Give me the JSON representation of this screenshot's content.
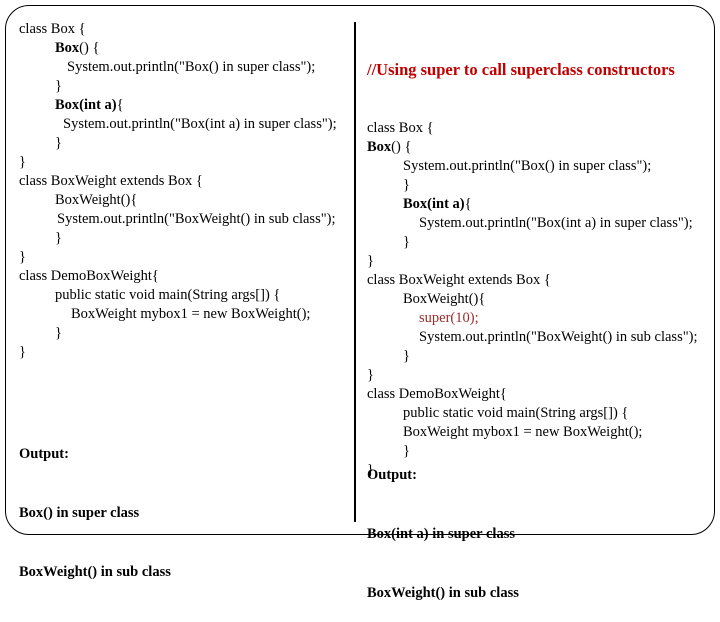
{
  "left_panel": {
    "code_lines": [
      {
        "text": "class Box {",
        "indent": 0,
        "bold": false
      },
      {
        "text": "Box() {",
        "indent": 1,
        "bold_prefix": "Box",
        "rest": "() {"
      },
      {
        "text": "System.out.println(\"Box() in super class\");",
        "indent": 2
      },
      {
        "text": "}",
        "indent": 1
      },
      {
        "text": "Box(int a){",
        "indent": 1,
        "bold_prefix": "Box(int a)",
        "rest": "{"
      },
      {
        "text": "System.out.println(\"Box(int a) in super class\");",
        "indent": 3
      },
      {
        "text": "}",
        "indent": 1
      },
      {
        "text": "}",
        "indent": 0
      },
      {
        "text": "class BoxWeight extends Box {",
        "indent": 0
      },
      {
        "text": "BoxWeight(){",
        "indent": 1
      },
      {
        "text": "System.out.println(\"BoxWeight() in sub class\");",
        "indent": 4
      },
      {
        "text": "}",
        "indent": 1
      },
      {
        "text": "}",
        "indent": 0
      },
      {
        "text": "class DemoBoxWeight{",
        "indent": 0
      },
      {
        "text": "public static void main(String args[]) {",
        "indent": 1
      },
      {
        "text": "BoxWeight mybox1 = new BoxWeight();",
        "indent": 5
      },
      {
        "text": "}",
        "indent": 1
      },
      {
        "text": "}",
        "indent": 0
      }
    ],
    "output": {
      "label": "Output:",
      "lines": [
        "Box() in super class",
        "BoxWeight() in sub class"
      ]
    }
  },
  "right_panel": {
    "heading": "//Using super to call superclass constructors",
    "code_lines": [
      {
        "text": "class Box {",
        "indent": 0
      },
      {
        "text": "Box() {",
        "indent": 0,
        "bold_prefix": "Box",
        "rest": "() {"
      },
      {
        "text": "System.out.println(\"Box() in super class\");",
        "indent": 2
      },
      {
        "text": "}",
        "indent": 2
      },
      {
        "text": "Box(int a){",
        "indent": 2,
        "bold_prefix": "Box(int a)",
        "rest": "{"
      },
      {
        "text": "System.out.println(\"Box(int a) in super class\");",
        "indent": 3
      },
      {
        "text": "}",
        "indent": 2
      },
      {
        "text": "}",
        "indent": 0
      },
      {
        "text": "class BoxWeight extends Box {",
        "indent": 0
      },
      {
        "text": "BoxWeight(){",
        "indent": 2
      },
      {
        "text": "super(10);",
        "indent": 3,
        "highlight": true
      },
      {
        "text": "System.out.println(\"BoxWeight() in sub class\");",
        "indent": 3
      },
      {
        "text": "}",
        "indent": 2
      },
      {
        "text": "}",
        "indent": 0
      },
      {
        "text": "class DemoBoxWeight{",
        "indent": 0
      },
      {
        "text": "public static void main(String args[]) {",
        "indent": 2
      },
      {
        "text": "BoxWeight mybox1 = new BoxWeight();",
        "indent": 4
      },
      {
        "text": "}",
        "indent": 2
      },
      {
        "text": "}",
        "indent": 0
      }
    ],
    "output": {
      "label": "Output:",
      "lines": [
        "Box(int a) in super class",
        "BoxWeight() in sub class"
      ]
    }
  },
  "colors": {
    "heading": "#C00000",
    "highlight": "#9B2C2C",
    "text": "#000000",
    "border": "#000000"
  }
}
